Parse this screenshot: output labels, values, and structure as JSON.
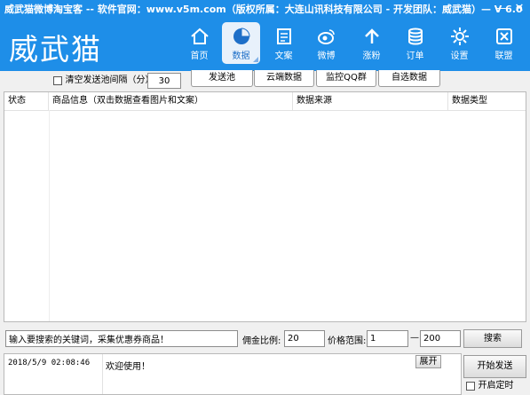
{
  "window": {
    "title": "威武猫微博淘宝客 -- 软件官网：www.v5m.com（版权所属：大连山讯科技有限公司 - 开发团队：威武猫）— V 6.0",
    "minimize": "—",
    "close": "✕"
  },
  "header": {
    "logo": "威武猫",
    "nav": [
      {
        "label": "首页",
        "icon": "home-icon"
      },
      {
        "label": "数据",
        "icon": "pie-chart-icon"
      },
      {
        "label": "文案",
        "icon": "document-icon"
      },
      {
        "label": "微博",
        "icon": "weibo-icon"
      },
      {
        "label": "涨粉",
        "icon": "arrow-up-icon"
      },
      {
        "label": "订单",
        "icon": "coin-stack-icon"
      },
      {
        "label": "设置",
        "icon": "gear-icon"
      },
      {
        "label": "联盟",
        "icon": "alliance-icon"
      }
    ]
  },
  "controls": {
    "clear_label": "清空发送池间隔（分）",
    "interval_value": "30"
  },
  "tabs": [
    "发送池",
    "云端数据",
    "监控QQ群",
    "自选数据"
  ],
  "table": {
    "columns": [
      "状态",
      "商品信息（双击数据查看图片和文案）",
      "数据来源",
      "数据类型"
    ]
  },
  "search": {
    "keyword_value": "输入要搜索的关键词，采集优惠券商品！",
    "commission_label": "佣金比例:",
    "commission_value": "20",
    "price_label": "价格范围:",
    "price_min": "1",
    "dash": "—",
    "price_max": "200",
    "search_button": "搜索"
  },
  "log": {
    "timestamp": "2018/5/9 02:08:46",
    "message": "欢迎使用！",
    "expand_button": "展开"
  },
  "actions": {
    "start_send": "开始发送",
    "start_timer": "开启定时"
  },
  "colors": {
    "brand_blue": "#1e8ee8",
    "active_tab_bg": "#e8f1fb"
  }
}
